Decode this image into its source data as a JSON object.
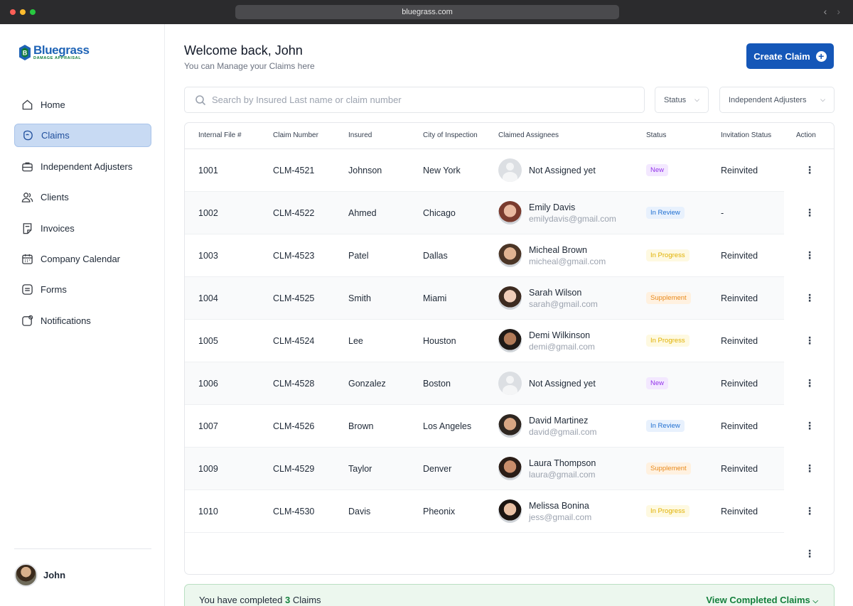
{
  "browser": {
    "url": "bluegrass.com"
  },
  "brand": {
    "name": "Bluegrass",
    "tagline": "DAMAGE APPRAISAL"
  },
  "sidebar": {
    "items": [
      {
        "label": "Home",
        "icon": "home-icon",
        "active": false
      },
      {
        "label": "Claims",
        "icon": "claims-icon",
        "active": true
      },
      {
        "label": "Independent Adjusters",
        "icon": "briefcase-icon",
        "active": false
      },
      {
        "label": "Clients",
        "icon": "clients-icon",
        "active": false
      },
      {
        "label": "Invoices",
        "icon": "invoice-icon",
        "active": false
      },
      {
        "label": "Company Calendar",
        "icon": "calendar-icon",
        "active": false
      },
      {
        "label": "Forms",
        "icon": "forms-icon",
        "active": false
      },
      {
        "label": "Notifications",
        "icon": "bell-icon",
        "active": false
      }
    ],
    "user": {
      "name": "John"
    }
  },
  "header": {
    "title": "Welcome back, John",
    "subtitle": "You can Manage your Claims here",
    "create_label": "Create Claim"
  },
  "filters": {
    "search_placeholder": "Search by Insured Last name or claim number",
    "status_label": "Status",
    "adjusters_label": "Independent Adjusters"
  },
  "table": {
    "columns": [
      "Internal File #",
      "Claim Number",
      "Insured",
      "City of Inspection",
      "Claimed Assignees",
      "Status",
      "Invitation Status",
      "Action"
    ],
    "rows": [
      {
        "file": "1001",
        "claim": "CLM-4521",
        "insured": "Johnson",
        "city": "New York",
        "assignee": "Not Assigned yet",
        "email": "",
        "status": "New",
        "invite": "Reinvited"
      },
      {
        "file": "1002",
        "claim": "CLM-4522",
        "insured": "Ahmed",
        "city": "Chicago",
        "assignee": "Emily Davis",
        "email": "emilydavis@gmail.com",
        "status": "In Review",
        "invite": "-"
      },
      {
        "file": "1003",
        "claim": "CLM-4523",
        "insured": "Patel",
        "city": "Dallas",
        "assignee": "Micheal Brown",
        "email": "micheal@gmail.com",
        "status": "In Progress",
        "invite": "Reinvited"
      },
      {
        "file": "1004",
        "claim": "CLM-4525",
        "insured": "Smith",
        "city": "Miami",
        "assignee": "Sarah Wilson",
        "email": "sarah@gmail.com",
        "status": "Supplement",
        "invite": "Reinvited"
      },
      {
        "file": "1005",
        "claim": "CLM-4524",
        "insured": "Lee",
        "city": "Houston",
        "assignee": "Demi Wilkinson",
        "email": "demi@gmail.com",
        "status": "In Progress",
        "invite": "Reinvited"
      },
      {
        "file": "1006",
        "claim": "CLM-4528",
        "insured": "Gonzalez",
        "city": "Boston",
        "assignee": "Not Assigned yet",
        "email": "",
        "status": "New",
        "invite": "Reinvited"
      },
      {
        "file": "1007",
        "claim": "CLM-4526",
        "insured": "Brown",
        "city": "Los Angeles",
        "assignee": "David Martinez",
        "email": "david@gmail.com",
        "status": "In Review",
        "invite": "Reinvited"
      },
      {
        "file": "1009",
        "claim": "CLM-4529",
        "insured": "Taylor",
        "city": "Denver",
        "assignee": "Laura Thompson",
        "email": "laura@gmail.com",
        "status": "Supplement",
        "invite": "Reinvited"
      },
      {
        "file": "1010",
        "claim": "CLM-4530",
        "insured": "Davis",
        "city": "Pheonix",
        "assignee": "Melissa Bonina",
        "email": "jess@gmail.com",
        "status": "In Progress",
        "invite": "Reinvited"
      }
    ]
  },
  "banner": {
    "prefix": "You have completed",
    "count": "3",
    "suffix": "Claims",
    "link_label": "View Completed Claims"
  },
  "colors": {
    "primary": "#1557b8",
    "active_nav": "#c8daf3",
    "success": "#15803d",
    "badge_new": "#9333ea",
    "badge_review": "#1f6fd1",
    "badge_progress": "#e0b100",
    "badge_supplement": "#e88a1c"
  }
}
